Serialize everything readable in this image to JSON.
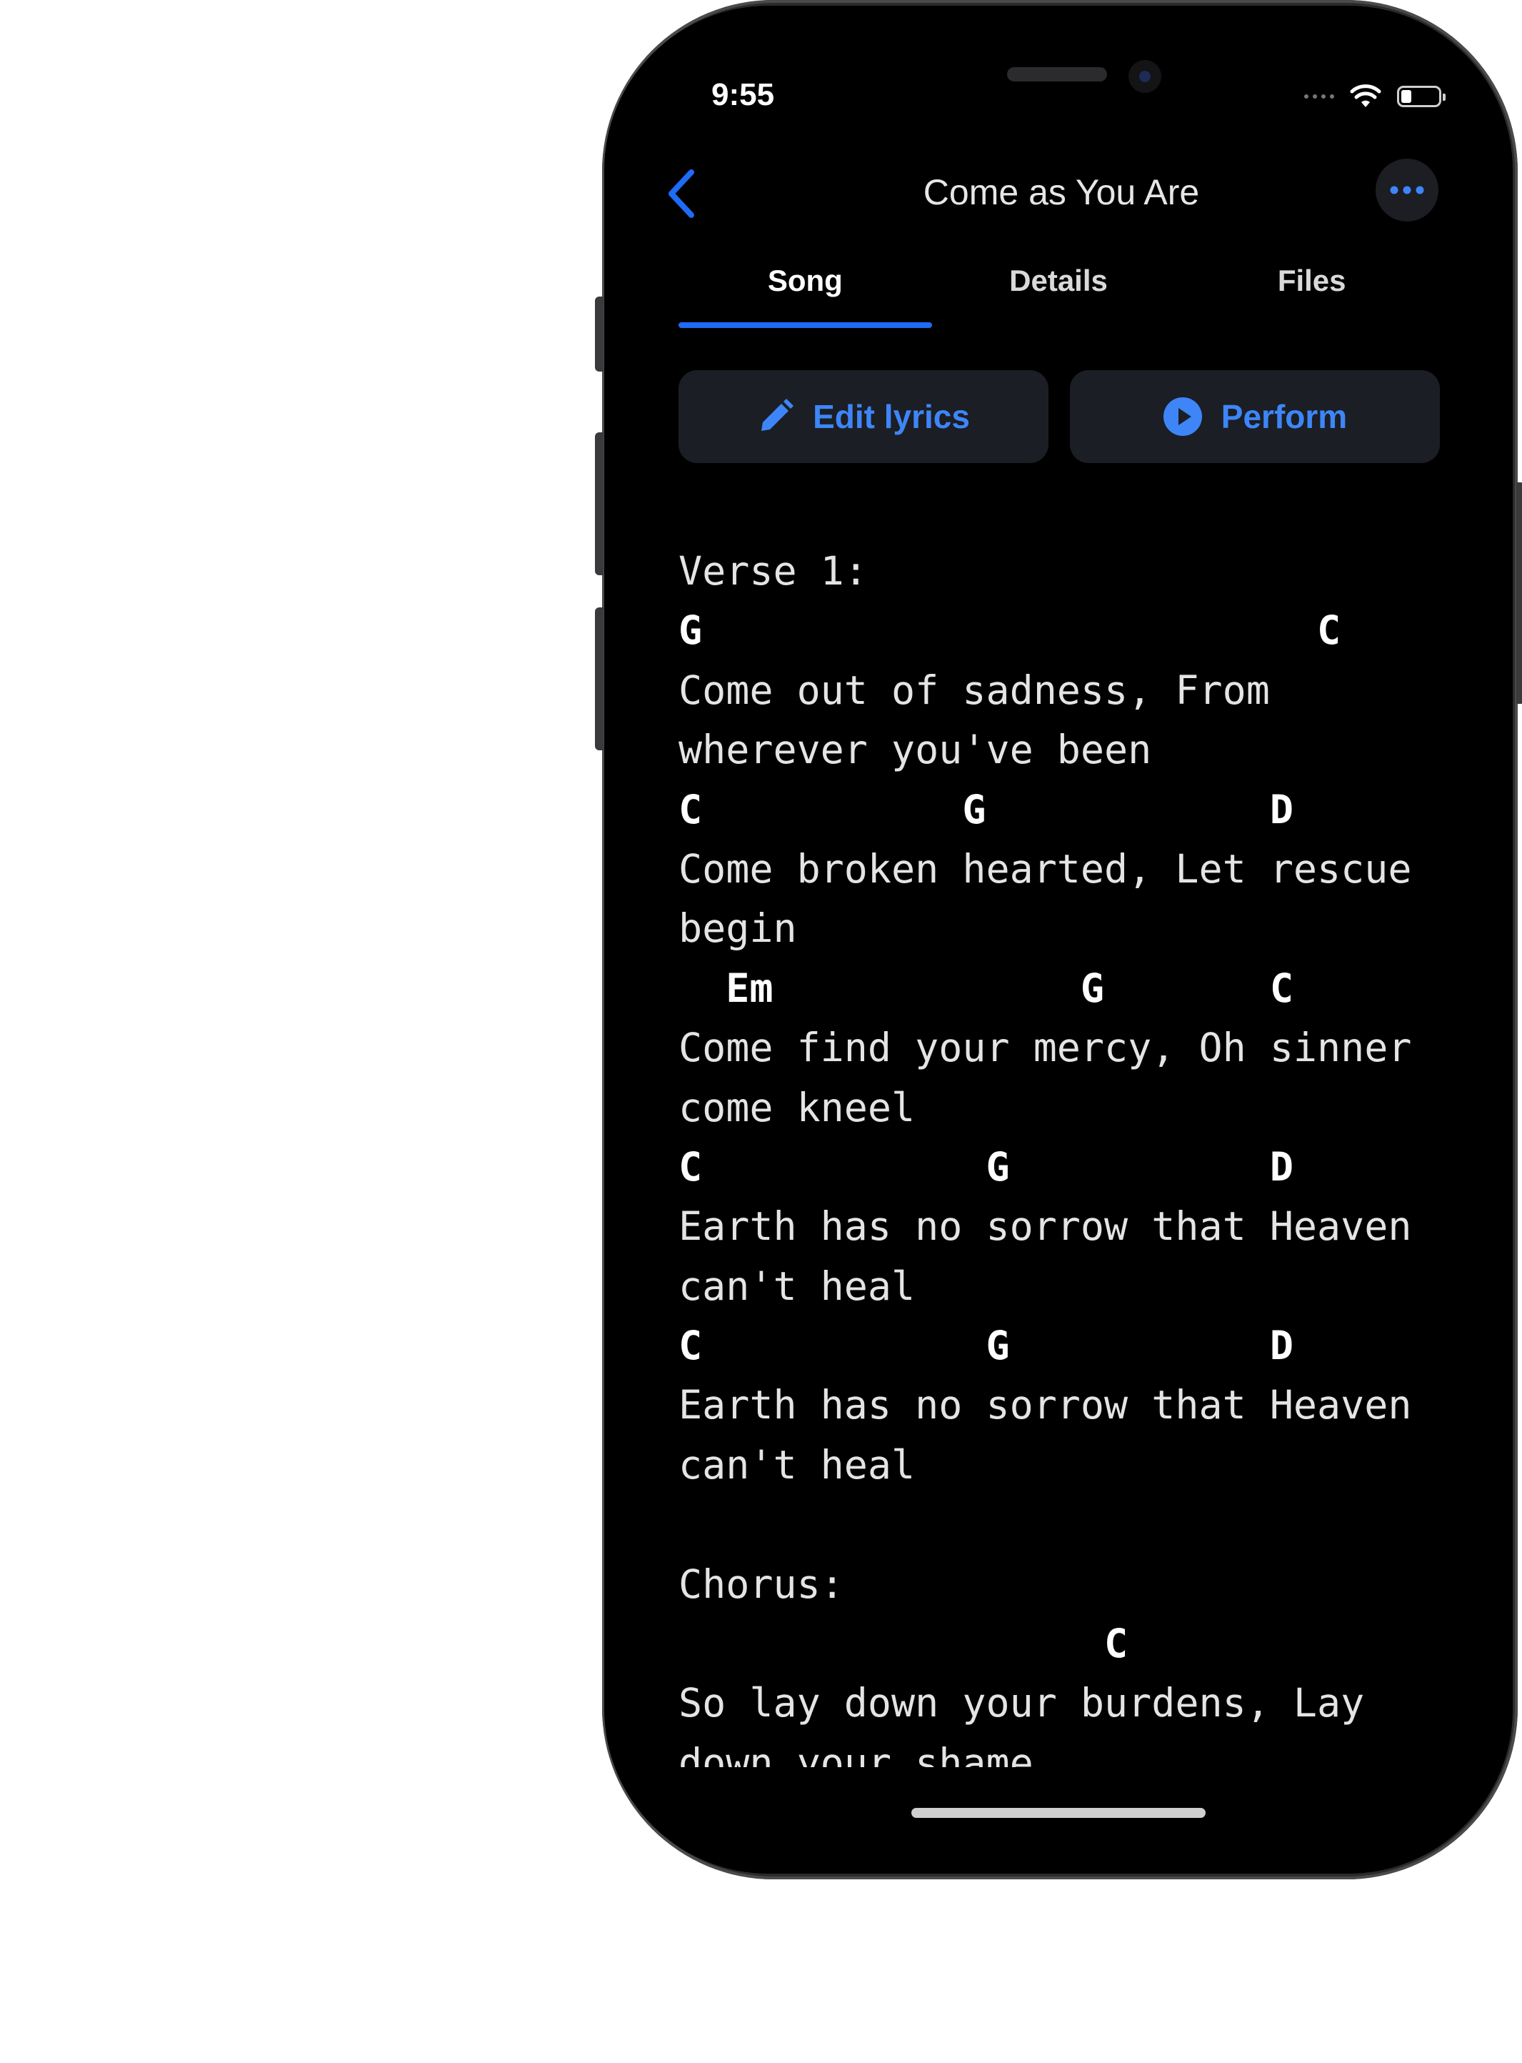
{
  "status_bar": {
    "time": "9:55"
  },
  "nav": {
    "title": "Come as You Are",
    "back_icon": "chevron-left-icon",
    "more_icon": "ellipsis-icon"
  },
  "tabs": [
    {
      "label": "Song",
      "active": true
    },
    {
      "label": "Details",
      "active": false
    },
    {
      "label": "Files",
      "active": false
    }
  ],
  "actions": {
    "edit_label": "Edit lyrics",
    "edit_icon": "pencil-icon",
    "perform_label": "Perform",
    "perform_icon": "play-circle-icon"
  },
  "sheet_lines": [
    {
      "type": "section",
      "text": "Verse 1:"
    },
    {
      "type": "chord",
      "text": "G                          C"
    },
    {
      "type": "lyric",
      "text": "Come out of sadness, From"
    },
    {
      "type": "lyric",
      "text": "wherever you've been"
    },
    {
      "type": "chord",
      "text": "C           G            D"
    },
    {
      "type": "lyric",
      "text": "Come broken hearted, Let rescue"
    },
    {
      "type": "lyric",
      "text": "begin"
    },
    {
      "type": "chord",
      "text": "  Em             G       C"
    },
    {
      "type": "lyric",
      "text": "Come find your mercy, Oh sinner"
    },
    {
      "type": "lyric",
      "text": "come kneel"
    },
    {
      "type": "chord",
      "text": "C            G           D"
    },
    {
      "type": "lyric",
      "text": "Earth has no sorrow that Heaven"
    },
    {
      "type": "lyric",
      "text": "can't heal"
    },
    {
      "type": "chord",
      "text": "C            G           D"
    },
    {
      "type": "lyric",
      "text": "Earth has no sorrow that Heaven"
    },
    {
      "type": "lyric",
      "text": "can't heal"
    },
    {
      "type": "blank",
      "text": ""
    },
    {
      "type": "section",
      "text": "Chorus:"
    },
    {
      "type": "chord",
      "text": "                  C"
    },
    {
      "type": "lyric",
      "text": "So lay down your burdens, Lay"
    },
    {
      "type": "lyric",
      "text": "down your shame"
    }
  ],
  "colors": {
    "accent": "#1e6bf5",
    "button_text": "#3e86f7",
    "button_bg": "#1b1e25",
    "background": "#000000"
  }
}
